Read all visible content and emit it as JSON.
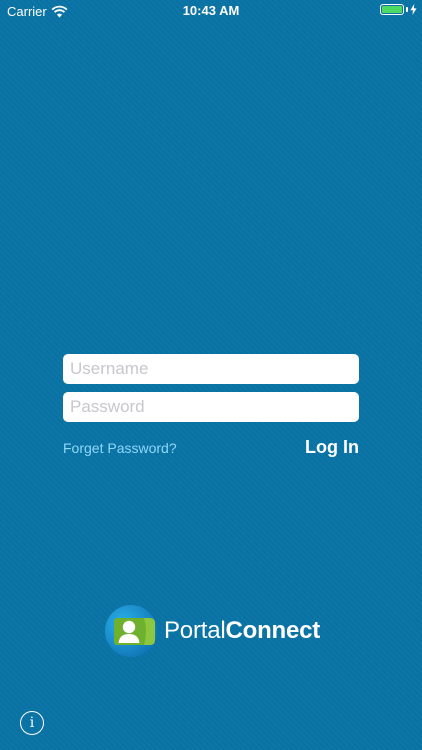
{
  "status_bar": {
    "carrier": "Carrier",
    "time": "10:43 AM",
    "wifi_icon": "wifi-icon",
    "battery_icon": "battery-icon",
    "battery_level": 1.0,
    "battery_color": "#4cd964",
    "charging_icon": "charging-bolt-icon"
  },
  "login_form": {
    "username_placeholder": "Username",
    "username_value": "",
    "password_placeholder": "Password",
    "password_value": "",
    "forgot_label": "Forget Password?",
    "login_label": "Log In"
  },
  "brand": {
    "logo_icon": "portalconnect-logo-icon",
    "name_light": "Portal",
    "name_bold": "Connect"
  },
  "footer": {
    "info_icon": "info-icon",
    "info_glyph": "i"
  },
  "colors": {
    "background": "#0a73a6",
    "link": "#8ed8f8",
    "logo_green": "#8dc63f",
    "logo_blue": "#1e9fd8"
  }
}
